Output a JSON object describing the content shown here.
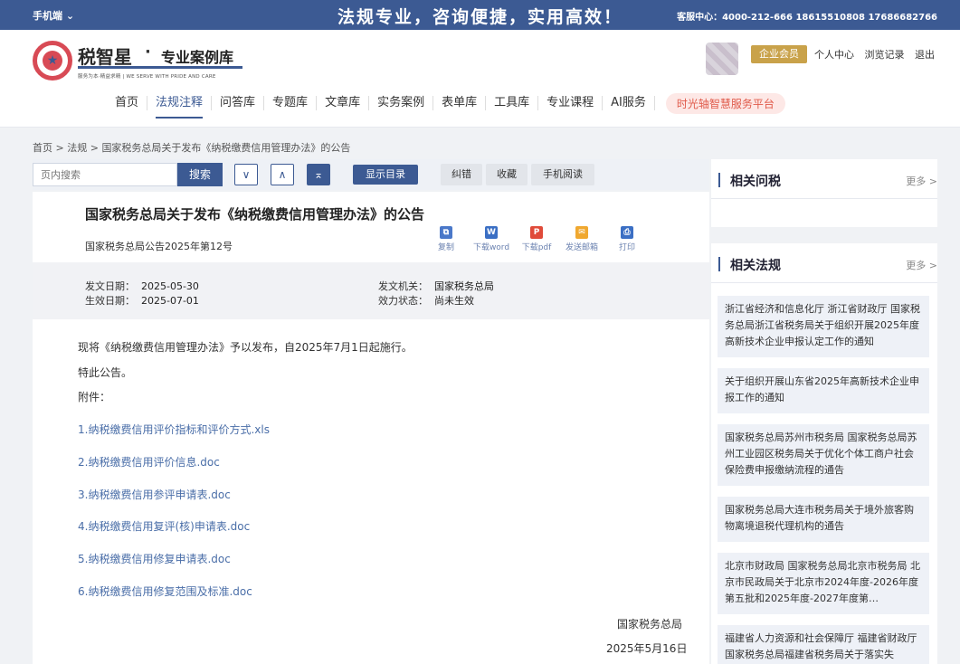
{
  "topbar": {
    "mobile": "手机端",
    "slogan": "法规专业，咨询便捷，实用高效！",
    "hotline": "客服中心：4000-212-666 18615510808 17686682766"
  },
  "brand": {
    "name": "税智星",
    "dot": "·",
    "sub": "专业案例库",
    "tagline": "服务为本·精益求精 | WE SERVE WITH PRIDE AND CARE"
  },
  "user": {
    "vip": "企业会员",
    "links": [
      "个人中心",
      "浏览记录",
      "退出"
    ]
  },
  "nav": {
    "items": [
      "首页",
      "法规注释",
      "问答库",
      "专题库",
      "文章库",
      "实务案例",
      "表单库",
      "工具库",
      "专业课程",
      "AI服务"
    ],
    "special": "时光轴智慧服务平台"
  },
  "breadcrumb": [
    "首页",
    " > ",
    "法规",
    " > ",
    "国家税务总局关于发布《纳税缴费信用管理办法》的公告"
  ],
  "toolbar": {
    "search_placeholder": "页内搜索",
    "search_label": "搜索",
    "down": "∨",
    "up": "∧",
    "top": "⌅",
    "toc": "显示目录",
    "correct": "纠错",
    "favorite": "收藏",
    "mobile_read": "手机阅读"
  },
  "doc": {
    "title": "国家税务总局关于发布《纳税缴费信用管理办法》的公告",
    "number": "国家税务总局公告2025年第12号",
    "actions": [
      {
        "label": "复制",
        "icon": "copy-icon",
        "color": "#4a78c9",
        "glyph": "⧉"
      },
      {
        "label": "下载word",
        "icon": "word-icon",
        "color": "#3b6fc4",
        "glyph": "W"
      },
      {
        "label": "下载pdf",
        "icon": "pdf-icon",
        "color": "#e04b3a",
        "glyph": "P"
      },
      {
        "label": "发送邮箱",
        "icon": "mail-icon",
        "color": "#f0a830",
        "glyph": "✉"
      },
      {
        "label": "打印",
        "icon": "print-icon",
        "color": "#3b6fc4",
        "glyph": "⎙"
      }
    ],
    "meta": {
      "issue_date_label": "发文日期：",
      "issue_date": "2025-05-30",
      "effective_date_label": "生效日期：",
      "effective_date": "2025-07-01",
      "issuer_label": "发文机关：",
      "issuer": "国家税务总局",
      "status_label": "效力状态：",
      "status": "尚未生效"
    },
    "body": [
      "现将《纳税缴费信用管理办法》予以发布，自2025年7月1日起施行。",
      "特此公告。",
      "附件："
    ],
    "attachments": [
      "1.纳税缴费信用评价指标和评价方式.xls",
      "2.纳税缴费信用评价信息.doc",
      "3.纳税缴费信用参评申请表.doc",
      "4.纳税缴费信用复评(核)申请表.doc",
      "5.纳税缴费信用修复申请表.doc",
      "6.纳税缴费信用修复范围及标准.doc"
    ],
    "signer": "国家税务总局",
    "sign_date": "2025年5月16日"
  },
  "sidebar": {
    "tax_qa": {
      "title": "相关问税",
      "more": "更多 >"
    },
    "related": {
      "title": "相关法规",
      "more": "更多 >",
      "items": [
        "浙江省经济和信息化厅 浙江省财政厅 国家税务总局浙江省税务局关于组织开展2025年度高新技术企业申报认定工作的通知",
        "关于组织开展山东省2025年高新技术企业申报工作的通知",
        "国家税务总局苏州市税务局 国家税务总局苏州工业园区税务局关于优化个体工商户社会保险费申报缴纳流程的通告",
        "国家税务总局大连市税务局关于境外旅客购物离境退税代理机构的通告",
        "北京市财政局 国家税务总局北京市税务局 北京市民政局关于北京市2024年度-2026年度第五批和2025年度-2027年度第…",
        "福建省人力资源和社会保障厅 福建省财政厅 国家税务总局福建省税务局关于落实失"
      ]
    }
  }
}
